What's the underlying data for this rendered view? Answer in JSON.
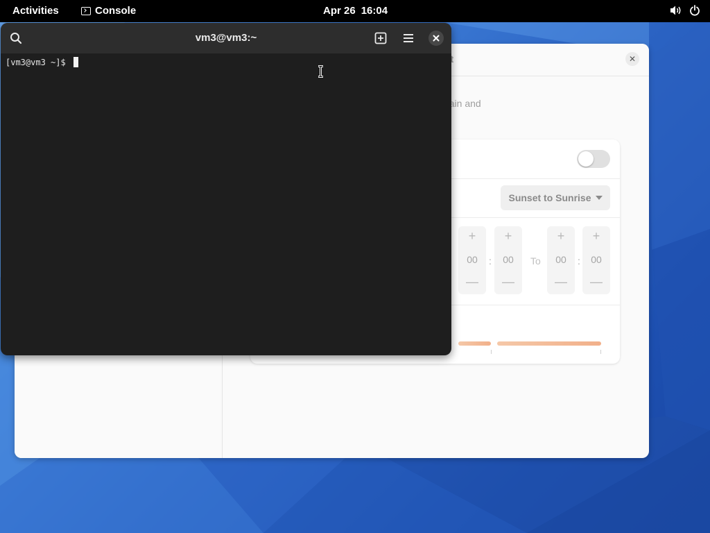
{
  "topbar": {
    "activities": "Activities",
    "app_name": "Console",
    "date": "Apr 26",
    "time": "16:04",
    "icons": [
      "terminal-icon",
      "volume-icon",
      "power-icon"
    ]
  },
  "settings": {
    "title_fragment": "ht",
    "description_fragment": "his can help to prevent eye strain and",
    "schedule_value": "Sunset to Sunrise",
    "from_hours": "00",
    "from_minutes": "00",
    "to_label": "To",
    "to_hours": "00",
    "to_minutes": "00",
    "spinner_plus": "+",
    "spinner_minus": "—",
    "colon": ":",
    "toggle_on": false
  },
  "console": {
    "title": "vm3@vm3:~",
    "prompt": "[vm3@vm3 ~]$ "
  },
  "colors": {
    "topbar": "#000000",
    "console_bg": "#1e1e1e",
    "console_header": "#2d2d2d",
    "settings_bg": "#fafafa",
    "slider_accent": "#f2b08a"
  }
}
